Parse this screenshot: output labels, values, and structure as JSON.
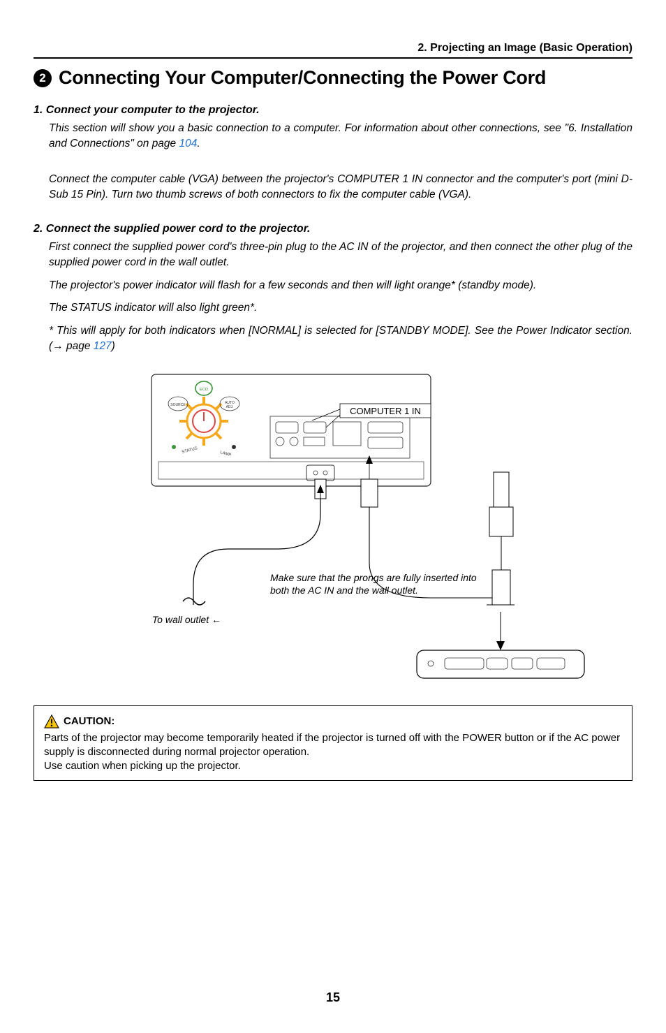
{
  "header": {
    "chapter": "2. Projecting an Image (Basic Operation)"
  },
  "title": {
    "bullet": "2",
    "text": "Connecting Your Computer/Connecting the Power Cord"
  },
  "step1": {
    "heading": "1.  Connect your computer to the projector.",
    "p1a": "This section will show you a basic connection to a computer. For information about other connections, see \"6. Installation and Connections\" on page ",
    "p1link": "104",
    "p1b": ".",
    "p2": "Connect the computer cable (VGA) between the projector's COMPUTER 1 IN connector and the computer's port (mini D-Sub 15 Pin). Turn two thumb screws of both connectors to fix the computer cable (VGA)."
  },
  "step2": {
    "heading": "2.  Connect the supplied power cord to the projector.",
    "p1": "First connect the supplied power cord's three-pin plug to the AC IN of the projector, and then connect the other plug of the supplied power cord in the wall outlet.",
    "p2": "The projector's power indicator will flash for a few seconds and then will light orange* (standby mode).",
    "p3": "The STATUS indicator will also light green*.",
    "p4a": "* This will apply for both indicators when [NORMAL] is selected for [STANDBY MODE]. See the Power Indicator section.(→ page ",
    "p4link": "127",
    "p4b": ")"
  },
  "figure": {
    "port_label": "COMPUTER 1 IN",
    "note": "Make sure that the prongs are fully inserted into both the AC IN and the wall outlet.",
    "to_outlet": "To wall outlet ←"
  },
  "caution": {
    "label": "CAUTION:",
    "body1": "Parts of the projector may become temporarily heated if the projector is turned off with the POWER button or if the AC power supply is disconnected during normal projector operation.",
    "body2": "Use caution when picking up the projector."
  },
  "page_number": "15"
}
